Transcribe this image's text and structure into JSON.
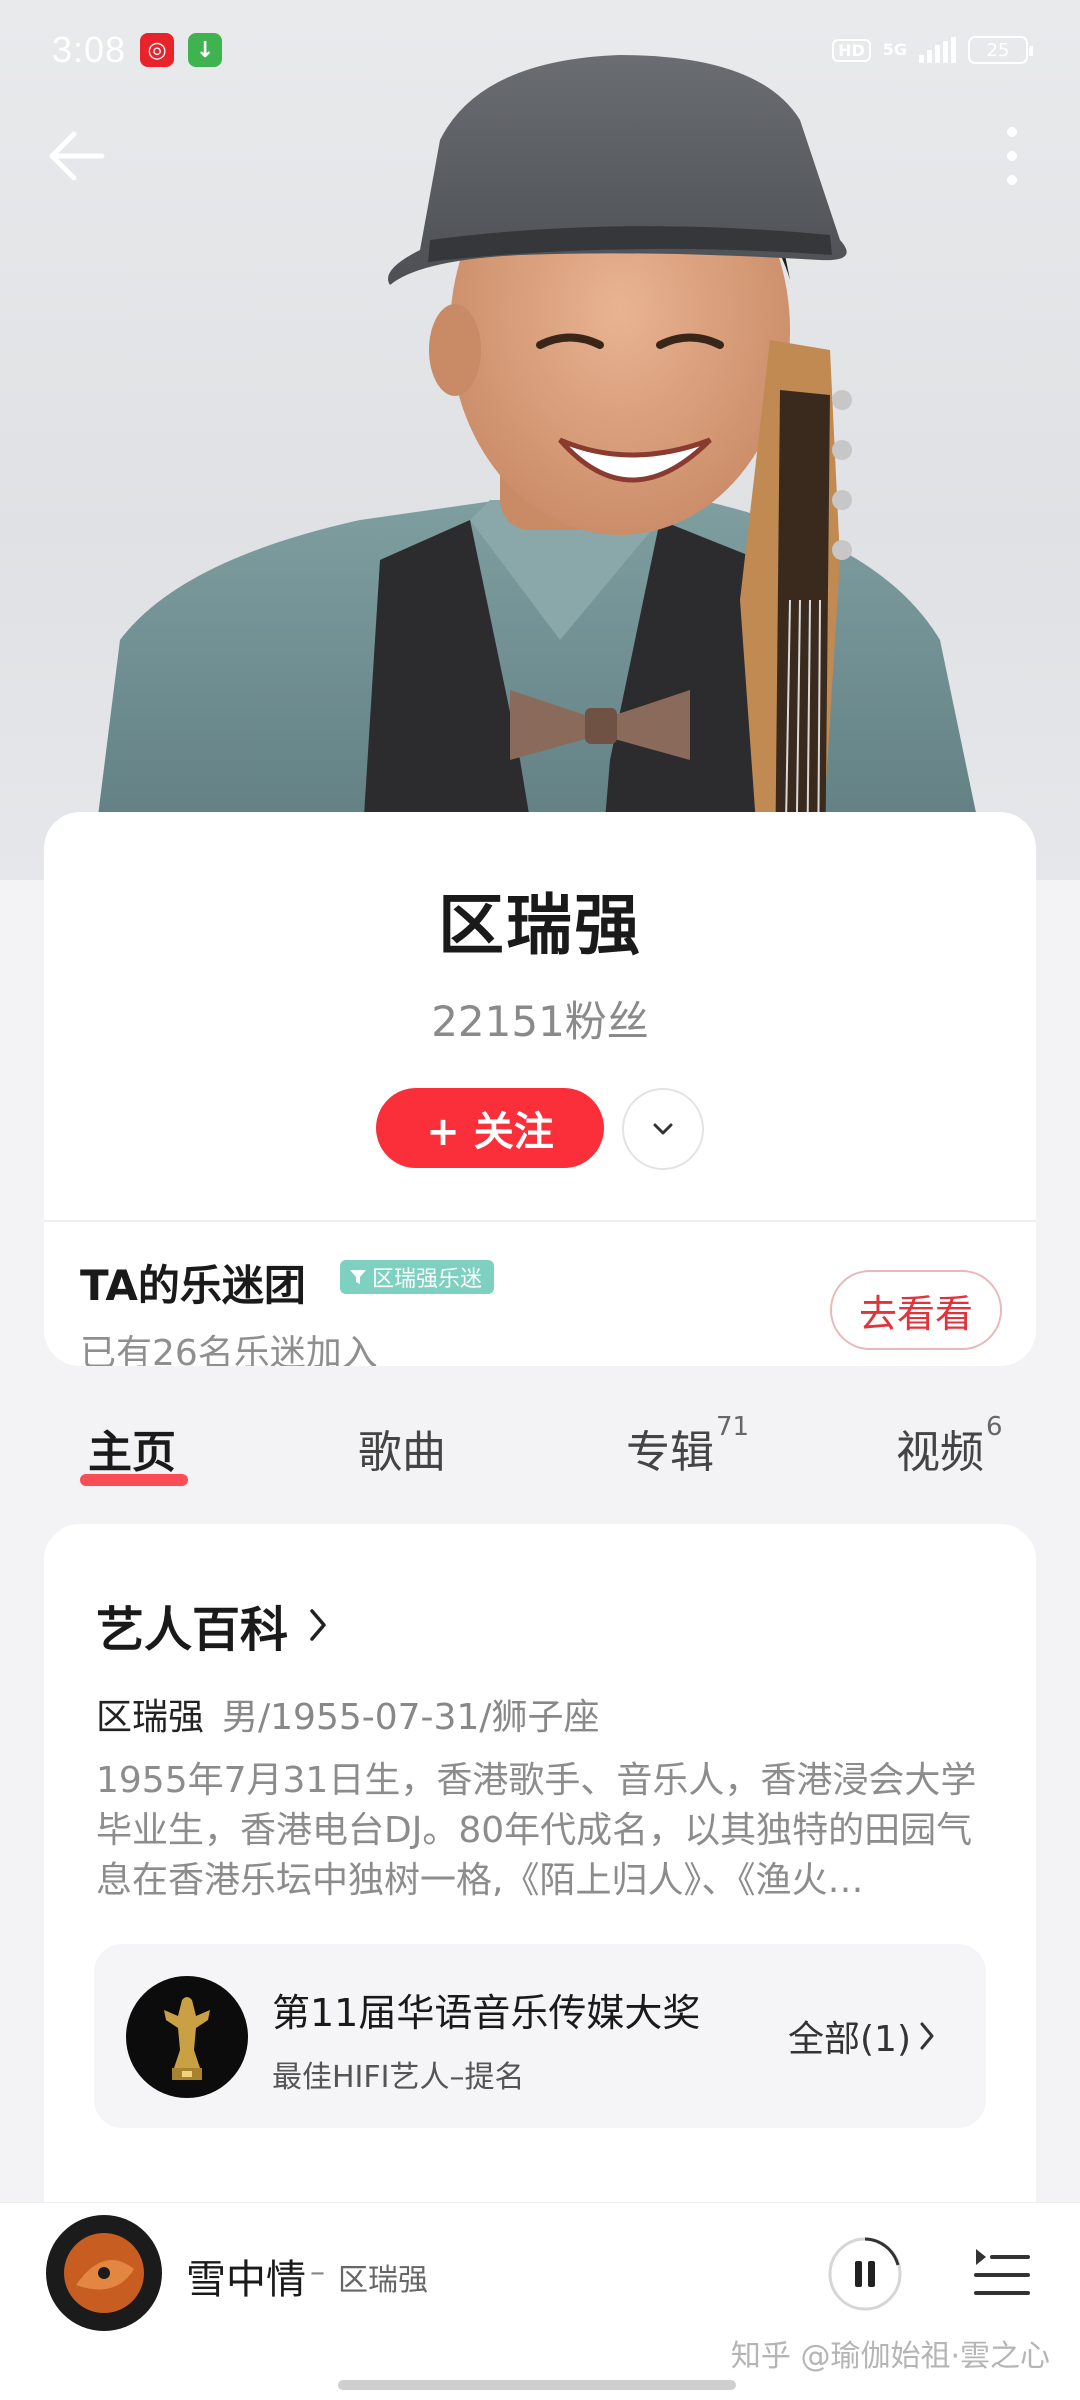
{
  "status_bar": {
    "time": "3:08",
    "network": "5G",
    "hd": "HD",
    "battery": "25"
  },
  "artist": {
    "name": "区瑞强",
    "fans_count": "22151",
    "fans_label": "粉丝"
  },
  "follow": {
    "label": "+ 关注"
  },
  "fanclub": {
    "title": "TA的乐迷团",
    "badge": "区瑞强乐迷",
    "subtitle": "已有26名乐迷加入",
    "button": "去看看"
  },
  "tabs": [
    {
      "label": "主页",
      "count": "",
      "active": true
    },
    {
      "label": "歌曲",
      "count": ""
    },
    {
      "label": "专辑",
      "count": "71"
    },
    {
      "label": "视频",
      "count": "6"
    }
  ],
  "baike": {
    "title": "艺人百科",
    "name": "区瑞强",
    "meta": "男/1955-07-31/狮子座",
    "description": "1955年7月31日生，香港歌手、音乐人，香港浸会大学毕业生，香港电台DJ。80年代成名，以其独特的田园气息在香港乐坛中独树一格,《陌上归人》、《渔火…",
    "award": {
      "title": "第11届华语音乐传媒大奖",
      "subtitle": "最佳HIFI艺人–提名",
      "all_label": "全部(1)"
    }
  },
  "player": {
    "song": "雪中情",
    "separator": "–",
    "artist": "区瑞强"
  },
  "watermark": "知乎 @瑜伽始祖·雲之心",
  "colors": {
    "accent_red": "#fb2f3a",
    "fanclub_badge": "#7ed0c0"
  }
}
